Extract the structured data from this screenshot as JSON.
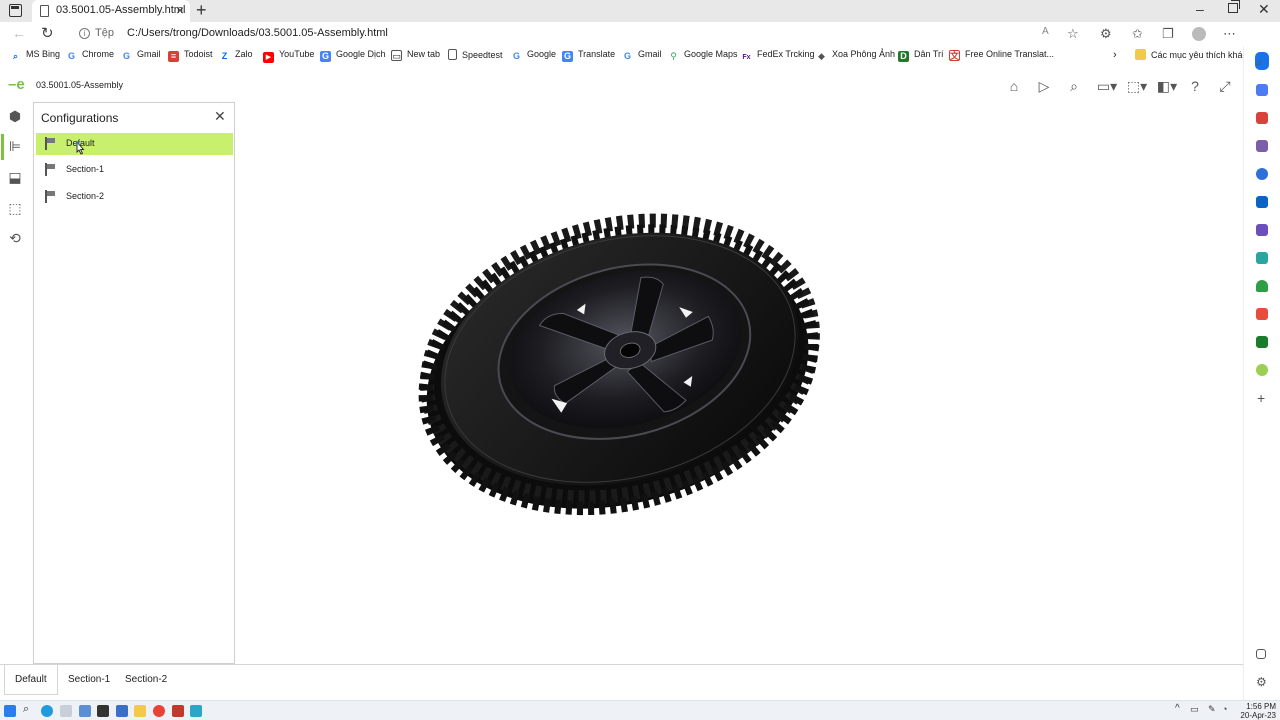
{
  "browser": {
    "tab_title": "03.5001.05-Assembly.html",
    "protocol_label": "Tệp",
    "url": "C:/Users/trong/Downloads/03.5001.05-Assembly.html"
  },
  "bookmarks": [
    {
      "label": "MS Bing",
      "icon": "search-icon",
      "color": "#1a73e8"
    },
    {
      "label": "Chrome",
      "icon": "google-icon",
      "color": "#4285f4"
    },
    {
      "label": "Gmail",
      "icon": "google-icon",
      "color": "#4285f4"
    },
    {
      "label": "Todoist",
      "icon": "todoist-icon",
      "color": "#db4035"
    },
    {
      "label": "Zalo",
      "icon": "zalo-icon",
      "color": "#0068ff"
    },
    {
      "label": "YouTube",
      "icon": "youtube-icon",
      "color": "#ff0000"
    },
    {
      "label": "Google Dịch",
      "icon": "translate-icon",
      "color": "#4285f4"
    },
    {
      "label": "New tab",
      "icon": "newtab-icon",
      "color": "#555555"
    },
    {
      "label": "Speedtest",
      "icon": "page-icon",
      "color": "#555555"
    },
    {
      "label": "Google",
      "icon": "google-icon",
      "color": "#4285f4"
    },
    {
      "label": "Translate",
      "icon": "translate-icon",
      "color": "#4285f4"
    },
    {
      "label": "Gmail",
      "icon": "google-icon",
      "color": "#4285f4"
    },
    {
      "label": "Google Maps",
      "icon": "maps-icon",
      "color": "#34a853"
    },
    {
      "label": "FedEx Trcking",
      "icon": "fedex-icon",
      "color": "#4d148c"
    },
    {
      "label": "Xoa Phông Ảnh",
      "icon": "photo-icon",
      "color": "#555555"
    },
    {
      "label": "Dân Trí",
      "icon": "dantri-icon",
      "color": "#1b7d2b"
    },
    {
      "label": "Free Online Translat...",
      "icon": "translate-icon",
      "color": "#d23f31"
    }
  ],
  "bookmarks_other": "Các mục yêu thích khác",
  "app": {
    "title": "03.5001.05-Assembly",
    "accent": "#7bc142"
  },
  "panel": {
    "title": "Configurations",
    "items": [
      {
        "label": "Default",
        "selected": true
      },
      {
        "label": "Section-1",
        "selected": false
      },
      {
        "label": "Section-2",
        "selected": false
      }
    ],
    "selection_color": "#c9ef6e"
  },
  "bottom_tabs": [
    "Default",
    "Section-1",
    "Section-2"
  ],
  "taskbar": {
    "time": "1:56 PM",
    "date": "20-Apr-23"
  }
}
